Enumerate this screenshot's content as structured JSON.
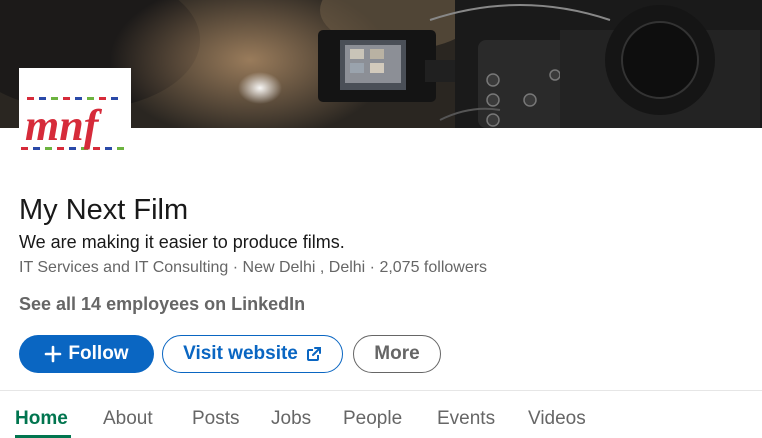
{
  "company": {
    "logo_text": "mnf",
    "name": "My Next Film",
    "tagline": "We are making it easier to produce films.",
    "meta": "IT Services and IT Consulting · New Delhi , Delhi · 2,075 followers",
    "employees_link": "See all 14 employees on LinkedIn"
  },
  "actions": {
    "follow_label": "Follow",
    "visit_label": "Visit website",
    "more_label": "More"
  },
  "tabs": [
    {
      "label": "Home",
      "active": true
    },
    {
      "label": "About"
    },
    {
      "label": "Posts"
    },
    {
      "label": "Jobs"
    },
    {
      "label": "People"
    },
    {
      "label": "Events"
    },
    {
      "label": "Videos"
    }
  ],
  "icons": {
    "follow": "plus-icon",
    "visit": "external-link-icon"
  },
  "colors": {
    "primary": "#0a66c2",
    "active_tab": "#01754f",
    "muted": "#666666",
    "text": "#191919"
  }
}
